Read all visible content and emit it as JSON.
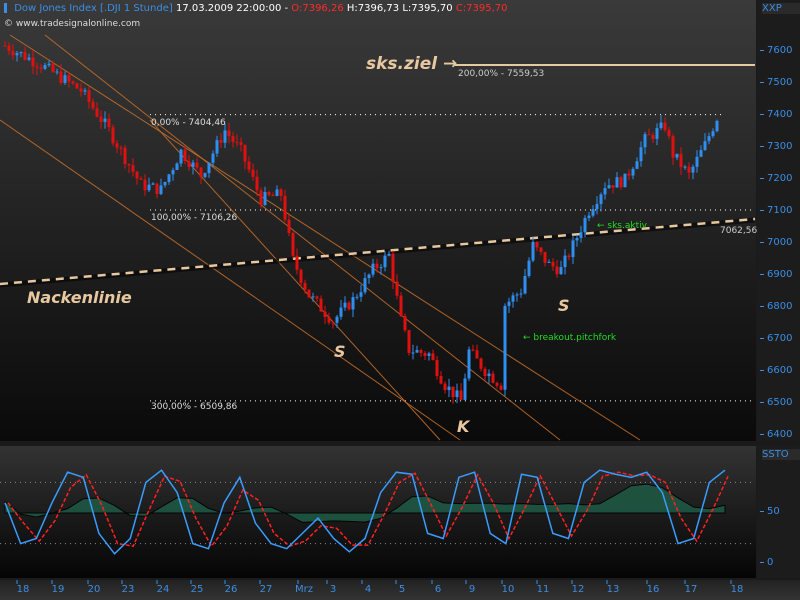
{
  "header": {
    "instrument": "Dow Jones Index [.DJI 1 Stunde]",
    "datetime": "17.03.2009 22:00:00 -",
    "open": "O:7396,26",
    "high": "H:7396,73",
    "low": "L:7395,70",
    "close": "C:7395,70",
    "source": "© www.tradesignalonline.com"
  },
  "axis_titles": {
    "price": "XXP",
    "ssto": "SSTO"
  },
  "annotations": {
    "target": "sks.ziel",
    "target_arrow": "→",
    "fib_200": "200,00% - 7559,53",
    "fib_0": "0,00% - 7404,46",
    "fib_100": "100,00% - 7106,26",
    "fib_300": "300,00% - 6509,86",
    "neckline": "Nackenlinie",
    "neckline_value": "7062,56",
    "sks_aktiv": "← sks.aktiv",
    "breakout": "← breakout.pitchfork",
    "s_left": "S",
    "s_right": "S",
    "k_head": "K"
  },
  "colors": {
    "up": "#2e8ff0",
    "down": "#e01010",
    "channel": "#c8702a",
    "neckline": "#e8c8a0",
    "fib": "#ffffff",
    "green_text": "#22dd22",
    "ssto_k": "#3a9cff",
    "ssto_d": "#ff2020",
    "ssto_fill": "#1f5a45"
  },
  "chart_data": {
    "type": "candlestick",
    "title": "Dow Jones Index [.DJI 1 Stunde]",
    "y_ticks": [
      7600,
      7500,
      7400,
      7300,
      7200,
      7100,
      7000,
      6900,
      6800,
      6700,
      6600,
      6500,
      6400
    ],
    "ylim": [
      6375,
      7640
    ],
    "x_ticks": [
      "18",
      "19",
      "20",
      "23",
      "24",
      "25",
      "26",
      "27",
      "Mrz",
      "3",
      "4",
      "5",
      "6",
      "9",
      "10",
      "11",
      "12",
      "13",
      "16",
      "17",
      "18"
    ],
    "price_path": [
      [
        0,
        7620
      ],
      [
        9,
        7560
      ],
      [
        19,
        7480
      ],
      [
        26,
        7355
      ],
      [
        34,
        7185
      ],
      [
        39,
        7170
      ],
      [
        44,
        7290
      ],
      [
        49,
        7215
      ],
      [
        55,
        7355
      ],
      [
        59,
        7290
      ],
      [
        64,
        7140
      ],
      [
        69,
        7155
      ],
      [
        72,
        6950
      ],
      [
        76,
        6840
      ],
      [
        82,
        6760
      ],
      [
        87,
        6825
      ],
      [
        92,
        6920
      ],
      [
        96,
        6965
      ],
      [
        99,
        6760
      ],
      [
        101,
        6670
      ],
      [
        106,
        6655
      ],
      [
        110,
        6560
      ],
      [
        114,
        6510
      ],
      [
        116,
        6665
      ],
      [
        120,
        6605
      ],
      [
        124,
        6560
      ],
      [
        125,
        6810
      ],
      [
        129,
        6855
      ],
      [
        132,
        6995
      ],
      [
        136,
        6935
      ],
      [
        139,
        6920
      ],
      [
        142,
        6995
      ],
      [
        146,
        7105
      ],
      [
        150,
        7185
      ],
      [
        155,
        7200
      ],
      [
        160,
        7325
      ],
      [
        165,
        7370
      ],
      [
        167,
        7280
      ],
      [
        171,
        7215
      ],
      [
        175,
        7310
      ],
      [
        178,
        7395
      ]
    ],
    "levels": {
      "fib_200": 7559.53,
      "fib_0": 7404.46,
      "fib_100": 7106.26,
      "fib_300": 6509.86,
      "neckline_end": 7062.56
    },
    "ssto": {
      "y_ticks": [
        50,
        0
      ],
      "ylim": [
        -10,
        110
      ],
      "k": [
        60,
        20,
        25,
        60,
        90,
        85,
        30,
        10,
        25,
        80,
        92,
        70,
        20,
        15,
        60,
        85,
        40,
        20,
        15,
        30,
        45,
        25,
        12,
        25,
        70,
        90,
        88,
        30,
        25,
        85,
        90,
        30,
        20,
        88,
        85,
        30,
        25,
        80,
        92,
        88,
        85,
        90,
        70,
        20,
        25,
        80,
        92
      ]
    }
  }
}
